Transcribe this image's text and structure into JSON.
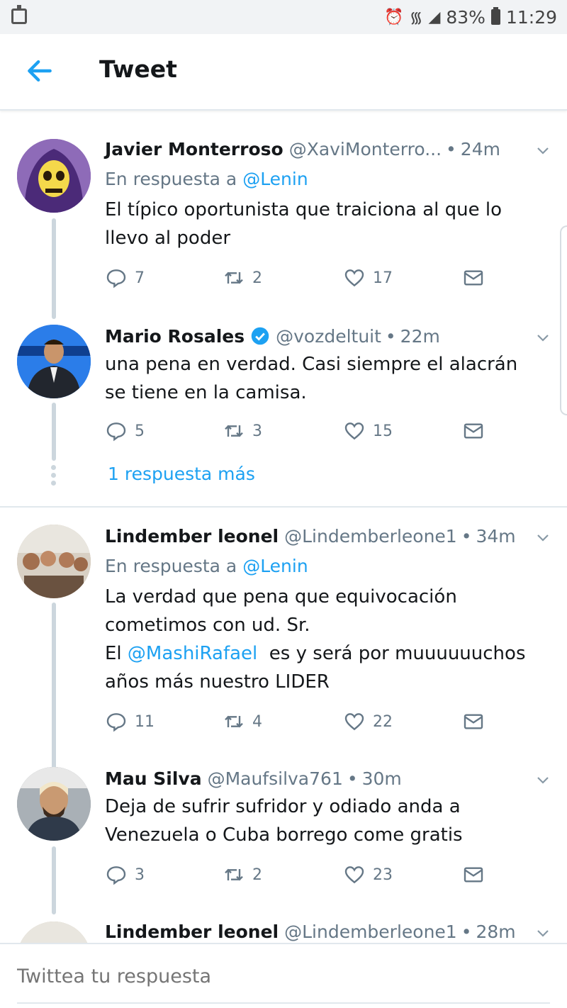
{
  "status_bar": {
    "battery_percent": "83%",
    "time": "11:29"
  },
  "header": {
    "title": "Tweet"
  },
  "colors": {
    "accent": "#1da1f2",
    "text": "#14171a",
    "secondary": "#657786"
  },
  "tweets": [
    {
      "name": "Javier Monterroso",
      "handle": "@XaviMonterro...",
      "sep": "•",
      "time": "24m",
      "reply_prefix": "En respuesta a",
      "reply_handle": "@Lenin",
      "text_lines": [
        "El típico oportunista que traiciona al que lo",
        "llevo al poder"
      ],
      "replies": "7",
      "retweets": "2",
      "likes": "17",
      "avatar": "skeletor-avatar"
    },
    {
      "name": "Mario Rosales",
      "verified": true,
      "handle": "@vozdeltuit",
      "sep": "•",
      "time": "22m",
      "text_lines": [
        "una pena en verdad. Casi siempre el alacrán",
        "se tiene en la camisa."
      ],
      "replies": "5",
      "retweets": "3",
      "likes": "15",
      "avatar": "news-anchor-avatar"
    },
    {
      "name": "Lindember leonel",
      "handle": "@Lindemberleone1",
      "sep": "•",
      "time": "34m",
      "reply_prefix": "En respuesta a",
      "reply_handle": "@Lenin",
      "line1": "La verdad que pena que equivocación",
      "line2": "cometimos con ud. Sr.",
      "line3_a": "El ",
      "line3_mention": "@MashiRafael",
      "line3_b": "  es y será por muuuuuuchos",
      "line4": "años más nuestro LIDER",
      "replies": "11",
      "retweets": "4",
      "likes": "22",
      "avatar": "family-photo-avatar"
    },
    {
      "name": "Mau Silva",
      "handle": "@Maufsilva761",
      "sep": "•",
      "time": "30m",
      "text_lines": [
        "Deja de sufrir sufridor y odiado anda a",
        "Venezuela o Cuba borrego come gratis"
      ],
      "replies": "3",
      "retweets": "2",
      "likes": "23",
      "avatar": "selfie-avatar"
    },
    {
      "name": "Lindember leonel",
      "handle": "@Lindemberleone1",
      "sep": "•",
      "time": "28m"
    }
  ],
  "more_replies": "1 respuesta más",
  "compose": {
    "placeholder": "Twittea tu respuesta"
  }
}
